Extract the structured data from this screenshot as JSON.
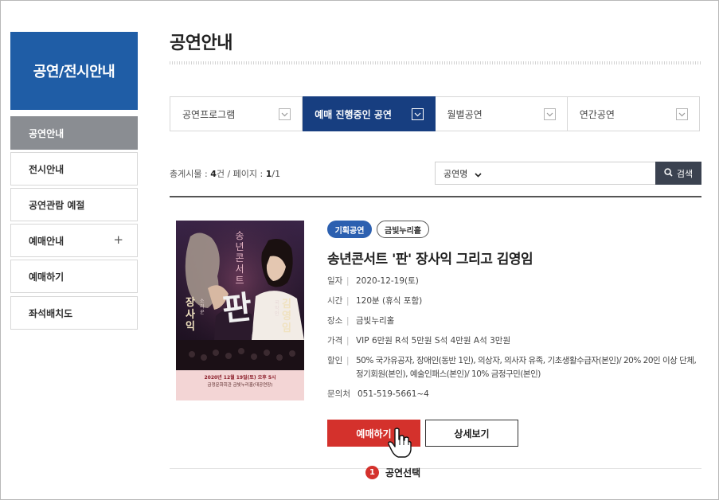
{
  "sidebar": {
    "title": "공연/전시안내",
    "items": [
      {
        "label": "공연안내",
        "active": true
      },
      {
        "label": "전시안내"
      },
      {
        "label": "공연관람 예절"
      },
      {
        "label": "예매안내",
        "expand": "+"
      },
      {
        "label": "예매하기"
      },
      {
        "label": "좌석배치도"
      }
    ]
  },
  "main": {
    "page_title": "공연안내",
    "tabs": [
      {
        "label": "공연프로그램"
      },
      {
        "label": "예매 진행중인 공연",
        "active": true
      },
      {
        "label": "월별공연"
      },
      {
        "label": "연간공연"
      }
    ],
    "count": {
      "total_label": "총게시물 : ",
      "total_value": "4",
      "total_unit": "건",
      "page_label": " / 페이지 : ",
      "page_current": "1",
      "page_total": "/1"
    },
    "search": {
      "select_value": "공연명",
      "input_value": "",
      "button_label": "검색"
    }
  },
  "event": {
    "badges": [
      "기획공연",
      "금빛누리홀"
    ],
    "title": "송년콘서트 '판' 장사익 그리고 김영임",
    "info": [
      {
        "key": "일자",
        "value": "2020-12-19(토)"
      },
      {
        "key": "시간",
        "value": "120분 (휴식 포함)"
      },
      {
        "key": "장소",
        "value": "금빛누리홀"
      },
      {
        "key": "가격",
        "value": "VIP 6만원 R석 5만원 S석 4만원 A석 3만원"
      },
      {
        "key": "할인",
        "value": "50% 국가유공자, 장애인(동반 1인), 의상자, 의사자 유족, 기초생활수급자(본인)/ 20% 20인 이상 단체,",
        "value2": "정기회원(본인), 예술인패스(본인)/ 10% 금정구민(본인)"
      },
      {
        "key": "문의처",
        "value": "051-519-5661~4"
      }
    ],
    "book_label": "예매하기",
    "detail_label": "상세보기"
  },
  "annotation": {
    "step": "1",
    "label": "공연선택"
  },
  "poster": {
    "title_vertical": "송년콘서트",
    "big_char": "판",
    "name_left": "장사익",
    "name_right": "김영임",
    "role_left": "소리꾼",
    "role_right": "국악인",
    "date_line": "2020년 12월 19일(토) 오후 5시",
    "venue_line": "금정문화회관 금빛누리홀(대공연장)"
  },
  "colors": {
    "sidebar_title_bg": "#1f5da6",
    "tab_active_bg": "#173e80",
    "book_button_bg": "#d4312c",
    "badge_blue": "#2c60b0"
  }
}
